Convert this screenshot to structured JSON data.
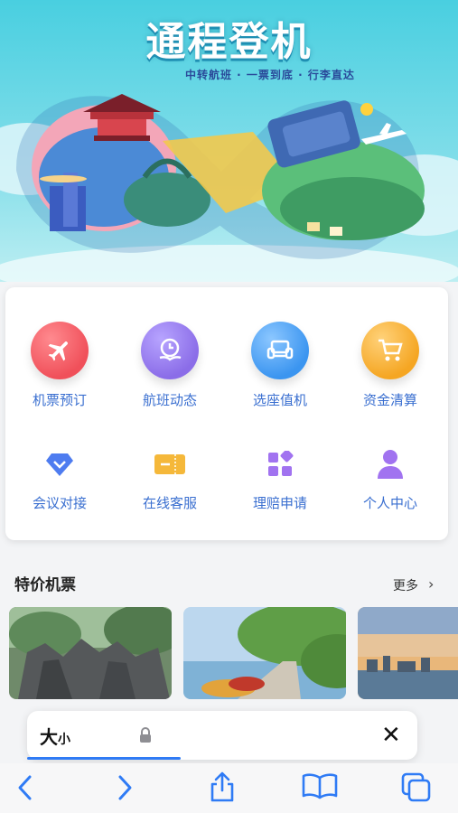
{
  "banner": {
    "title": "通程登机",
    "subtitle": "中转航班 · 一票到底 · 行李直达"
  },
  "menu": {
    "items": [
      {
        "label": "机票预订",
        "icon": "plane-icon",
        "color": "#f0505a"
      },
      {
        "label": "航班动态",
        "icon": "clock-hand-icon",
        "color": "#8b6de8"
      },
      {
        "label": "选座值机",
        "icon": "seat-icon",
        "color": "#3b95f0"
      },
      {
        "label": "资金清算",
        "icon": "cart-icon",
        "color": "#f5a623"
      },
      {
        "label": "会议对接",
        "icon": "diamond-icon",
        "color": "#4e7cf0"
      },
      {
        "label": "在线客服",
        "icon": "ticket-icon",
        "color": "#f5b83a"
      },
      {
        "label": "理赔申请",
        "icon": "apps-icon",
        "color": "#a173f0"
      },
      {
        "label": "个人中心",
        "icon": "person-icon",
        "color": "#a173f0"
      }
    ]
  },
  "section": {
    "title": "特价机票",
    "more": "更多"
  },
  "browser": {
    "text_size_label": "大",
    "text_size_small": "小",
    "colors": {
      "progress": "#2f7bf5",
      "accent": "#2f7bf5"
    }
  }
}
